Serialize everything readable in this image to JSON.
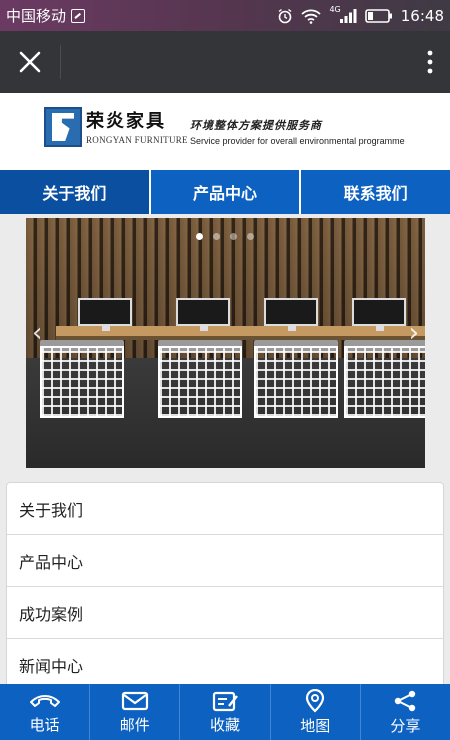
{
  "status_bar": {
    "carrier": "中国移动",
    "network": "4G",
    "time": "16:48"
  },
  "header": {
    "logo_cn": "荣炎家具",
    "logo_en": "RONGYAN FURNITURE",
    "tagline_cn": "环境整体方案提供服务商",
    "tagline_en": "Service provider for overall environmental programme"
  },
  "nav": {
    "items": [
      {
        "label": "关于我们"
      },
      {
        "label": "产品中心"
      },
      {
        "label": "联系我们"
      }
    ]
  },
  "banner": {
    "slide_count": 4,
    "active_slide": 1
  },
  "menu": {
    "items": [
      {
        "label": "关于我们"
      },
      {
        "label": "产品中心"
      },
      {
        "label": "成功案例"
      },
      {
        "label": "新闻中心"
      }
    ]
  },
  "bottom_bar": {
    "items": [
      {
        "label": "电话",
        "icon": "phone-icon"
      },
      {
        "label": "邮件",
        "icon": "mail-icon"
      },
      {
        "label": "收藏",
        "icon": "bookmark-icon"
      },
      {
        "label": "地图",
        "icon": "map-pin-icon"
      },
      {
        "label": "分享",
        "icon": "share-icon"
      }
    ]
  },
  "colors": {
    "brand_blue": "#0c61c1",
    "app_bar": "#333538"
  }
}
